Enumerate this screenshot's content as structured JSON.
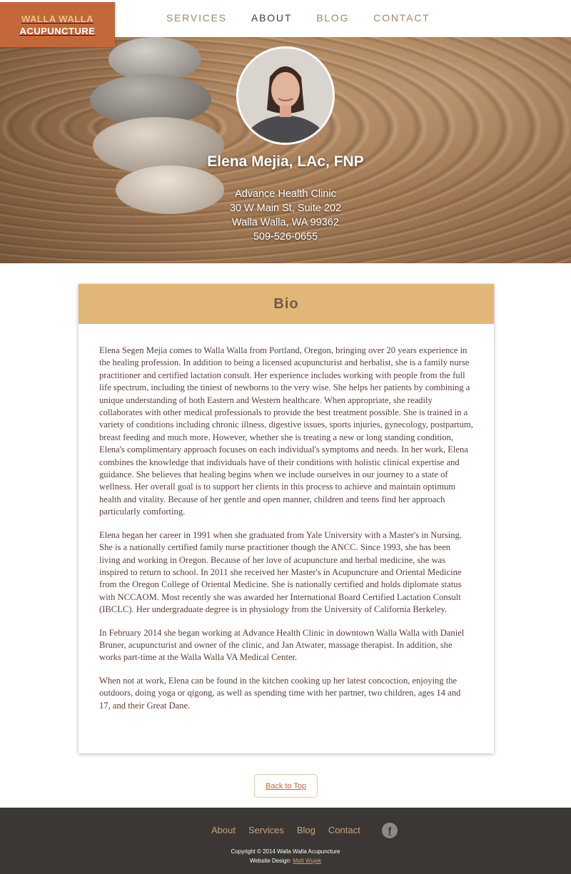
{
  "header": {
    "logo_line1": "WALLA WALLA",
    "logo_line2": "ACUPUNCTURE",
    "nav": [
      {
        "label": "SERVICES"
      },
      {
        "label": "ABOUT"
      },
      {
        "label": "BLOG"
      },
      {
        "label": "CONTACT"
      }
    ],
    "active_nav": "ABOUT"
  },
  "hero": {
    "name": "Elena Mejia, LAc, FNP",
    "clinic": "Advance Health Clinic",
    "street": "30 W Main St, Suite 202",
    "city": "Walla Walla, WA  99362",
    "phone": "509-526-0655"
  },
  "bio": {
    "title": "Bio",
    "paragraphs": [
      "Elena Segen Mejia comes to Walla Walla from Portland, Oregon, bringing over 20 years experience in the healing profession. In addition to being a licensed acupuncturist and herbalist, she is a family nurse practitioner and certified lactation consult. Her experience includes working with people from the full life spectrum, including the tiniest of newborns to the very wise. She helps her patients by combining a unique understanding of both Eastern and Western healthcare. When appropriate, she readily collaborates with other medical professionals to provide the best treatment possible. She is trained in a variety of conditions including chronic illness, digestive issues, sports injuries, gynecology, postpartum, breast feeding and much more. However, whether she is treating a new or long standing condition, Elena's complimentary approach focuses on each individual's symptoms and needs. In her work, Elena combines the knowledge that individuals have of their conditions with holistic clinical expertise and guidance. She believes that healing begins when we include ourselves in our journey to a state of wellness. Her overall goal is to support her clients in this process to achieve and maintain optimum health and vitality. Because of her gentle and open manner, children and teens find her approach particularly comforting.",
      "Elena began her career in 1991 when she graduated from Yale University with a Master's in Nursing. She is a nationally certified family nurse practitioner though the ANCC. Since 1993, she has been living and working in Oregon. Because of her love of acupuncture and herbal medicine, she was inspired to return to school. In 2011 she received her Master's in Acupuncture and Oriental Medicine from the Oregon College of Oriental Medicine. She is nationally certified and holds diplomate status with NCCAOM. Most recently she was awarded her International Board Certified Lactation Consult (IBCLC). Her undergraduate degree is in physiology from the University of California Berkeley.",
      "In February 2014 she began working at Advance Health Clinic in downtown Walla Walla with Daniel Bruner, acupuncturist and owner of the clinic, and Jan Atwater, massage therapist. In addition, she works part-time at the Walla Walla VA Medical Center.",
      "When not at work, Elena can be found in the kitchen cooking up her latest concoction, enjoying the outdoors, doing yoga or qigong, as well as spending time with her partner, two children, ages 14 and 17, and their Great Dane."
    ]
  },
  "back_to_top": "Back to Top",
  "footer": {
    "nav": [
      {
        "label": "About"
      },
      {
        "label": "Services"
      },
      {
        "label": "Blog"
      },
      {
        "label": "Contact"
      }
    ],
    "social_icon": "facebook-icon",
    "facebook_glyph": "f",
    "copyright": "Copyright © 2014 Walla Walla Acupuncture",
    "design_label": "Website Design:",
    "designer": "Matt Wujek"
  },
  "colors": {
    "logo_bg": "#c4683a",
    "logo_accent": "#f3c27a",
    "nav_text": "#a08766",
    "card_header": "#e2b677",
    "footer_bg": "#3a3734",
    "footer_link": "#c9a27a"
  }
}
